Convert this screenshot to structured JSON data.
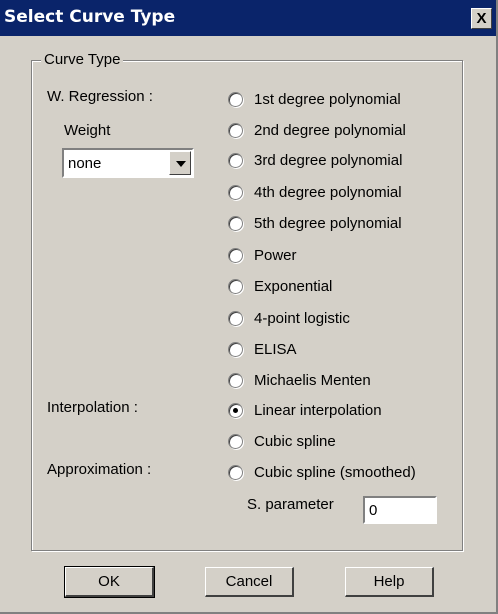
{
  "window": {
    "title": "Select Curve Type",
    "close_label": "X"
  },
  "group": {
    "legend": "Curve Type"
  },
  "labels": {
    "w_regression": "W. Regression :",
    "weight": "Weight",
    "interpolation": "Interpolation :",
    "approximation": "Approximation :",
    "s_parameter": "S. parameter"
  },
  "weight_select": {
    "value": "none"
  },
  "curve_types": [
    {
      "label": "1st degree polynomial",
      "checked": false
    },
    {
      "label": "2nd degree polynomial",
      "checked": false
    },
    {
      "label": "3rd degree polynomial",
      "checked": false
    },
    {
      "label": "4th degree polynomial",
      "checked": false
    },
    {
      "label": "5th degree polynomial",
      "checked": false
    },
    {
      "label": "Power",
      "checked": false
    },
    {
      "label": "Exponential",
      "checked": false
    },
    {
      "label": "4-point logistic",
      "checked": false
    },
    {
      "label": "ELISA",
      "checked": false
    },
    {
      "label": "Michaelis Menten",
      "checked": false
    },
    {
      "label": "Linear interpolation",
      "checked": true
    },
    {
      "label": "Cubic spline",
      "checked": false
    },
    {
      "label": "Cubic spline (smoothed)",
      "checked": false
    }
  ],
  "s_parameter_value": "0",
  "buttons": {
    "ok": "OK",
    "cancel": "Cancel",
    "help": "Help"
  }
}
